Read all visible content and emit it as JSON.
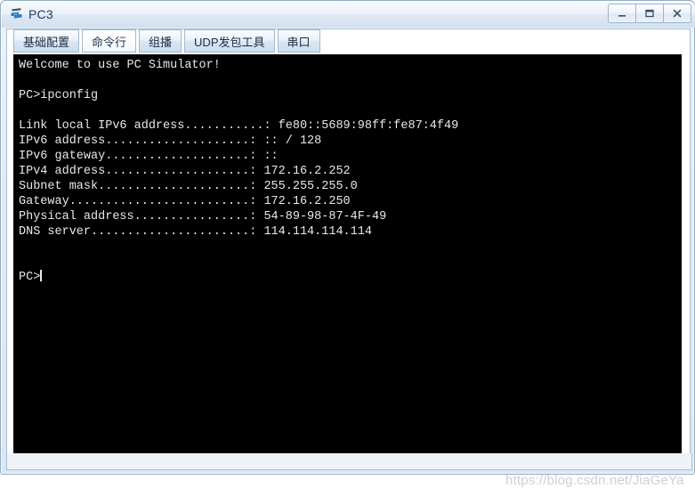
{
  "window": {
    "title": "PC3",
    "icon": "pc-device-icon",
    "controls": [
      {
        "name": "minimize",
        "label": "–"
      },
      {
        "name": "maximize",
        "label": "□"
      },
      {
        "name": "close",
        "label": "X"
      }
    ]
  },
  "tabs": [
    {
      "label": "基础配置",
      "name": "tab-basic-config",
      "active": false
    },
    {
      "label": "命令行",
      "name": "tab-command-line",
      "active": true
    },
    {
      "label": "组播",
      "name": "tab-multicast",
      "active": false
    },
    {
      "label": "UDP发包工具",
      "name": "tab-udp-tool",
      "active": false
    },
    {
      "label": "串口",
      "name": "tab-serial-port",
      "active": false
    }
  ],
  "terminal": {
    "background": "#000000",
    "foreground": "#e8e8e8",
    "lines": [
      "Welcome to use PC Simulator!",
      "",
      "PC>ipconfig",
      "",
      "Link local IPv6 address...........: fe80::5689:98ff:fe87:4f49",
      "IPv6 address....................: :: / 128",
      "IPv6 gateway....................: ::",
      "IPv4 address....................: 172.16.2.252",
      "Subnet mask.....................: 255.255.255.0",
      "Gateway.........................: 172.16.2.250",
      "Physical address................: 54-89-98-87-4F-49",
      "DNS server......................: 114.114.114.114",
      "",
      ""
    ],
    "prompt": "PC>"
  },
  "watermark": {
    "text": "https://blog.csdn.net/JiaGeYa"
  }
}
